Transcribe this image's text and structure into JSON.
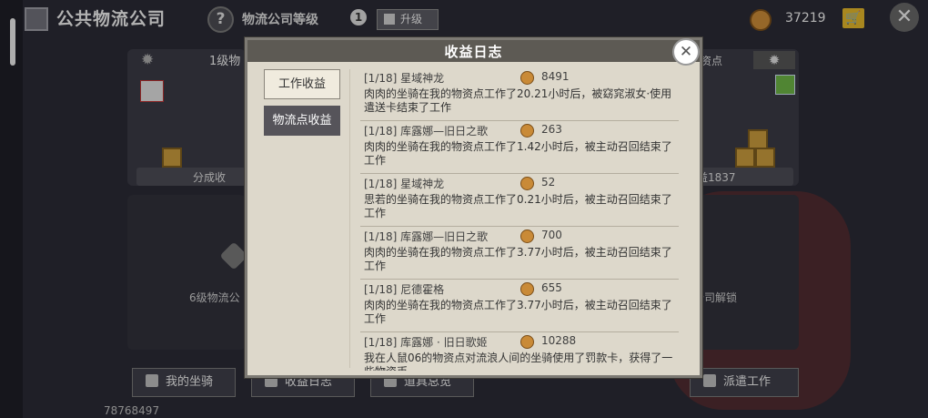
{
  "topbar": {
    "title": "公共物流公司",
    "help": "?",
    "level_label": "物流公司等级",
    "level_value": "1",
    "upgrade_label": "升级",
    "coin_amount": "37219"
  },
  "background": {
    "left_level": "1级物",
    "right_point": "资点",
    "left_bar_text": "分成收",
    "right_bar_text": "益1837",
    "left_locked_text": "6级物流公",
    "right_locked_text": "公司解锁"
  },
  "bottom_bar": {
    "my_mount": "我的坐骑",
    "income_log": "收益日志",
    "item_overview": "道具总览",
    "dispatch": "派遣工作",
    "player_id": "78768497"
  },
  "modal": {
    "title": "收益日志",
    "tabs": [
      {
        "label": "工作收益"
      },
      {
        "label": "物流点收益"
      }
    ],
    "entries": [
      {
        "head": "[1/18]  星域神龙",
        "amount": "8491",
        "body": "肉肉的坐骑在我的物资点工作了20.21小时后，被窈窕淑女·使用遣送卡结束了工作"
      },
      {
        "head": "[1/18]  库露娜—旧日之歌",
        "amount": "263",
        "body": "肉肉的坐骑在我的物资点工作了1.42小时后，被主动召回结束了工作"
      },
      {
        "head": "[1/18]  星域神龙",
        "amount": "52",
        "body": "思若的坐骑在我的物资点工作了0.21小时后，被主动召回结束了工作"
      },
      {
        "head": "[1/18]  库露娜—旧日之歌",
        "amount": "700",
        "body": "肉肉的坐骑在我的物资点工作了3.77小时后，被主动召回结束了工作"
      },
      {
        "head": "[1/18]  尼德霍格",
        "amount": "655",
        "body": "肉肉的坐骑在我的物资点工作了3.77小时后，被主动召回结束了工作"
      },
      {
        "head": "[1/18]  库露娜 · 旧日歌姬",
        "amount": "10288",
        "body": "我在人鼠06的物资点对流浪人间的坐骑使用了罚款卡，获得了一些物资币"
      }
    ]
  }
}
